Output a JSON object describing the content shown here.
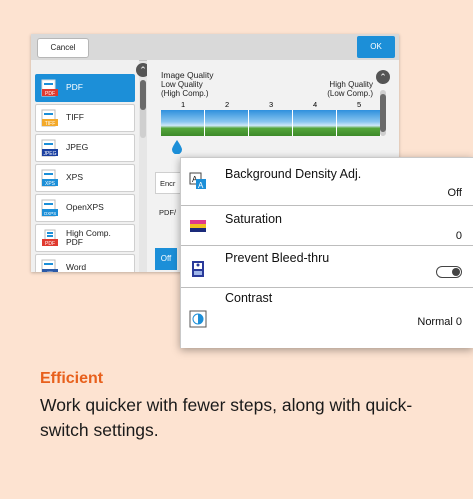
{
  "topbar": {
    "cancel_label": "Cancel",
    "ok_label": "OK"
  },
  "file_types": [
    {
      "label": "PDF",
      "icon": "pdf-file-icon",
      "badge": "PDF",
      "selected": true
    },
    {
      "label": "TIFF",
      "icon": "tiff-file-icon",
      "badge": "TIFF"
    },
    {
      "label": "JPEG",
      "icon": "jpeg-file-icon",
      "badge": "JPEG"
    },
    {
      "label": "XPS",
      "icon": "xps-file-icon",
      "badge": "XPS"
    },
    {
      "label": "OpenXPS",
      "icon": "openxps-file-icon",
      "badge": "OXPS"
    },
    {
      "label": "High Comp. PDF",
      "icon": "high-comp-pdf-icon",
      "badge": "PDF"
    },
    {
      "label": "Word",
      "icon": "word-file-icon",
      "badge": "W"
    }
  ],
  "image_quality": {
    "title": "Image Quality",
    "low_label": "Low Quality\n(High Comp.)",
    "high_label": "High Quality\n(Low Comp.)",
    "scale": [
      "1",
      "2",
      "3",
      "4",
      "5"
    ],
    "selected_level": 1
  },
  "subpanel": {
    "encr_label": "Encr",
    "pdfa_label": "PDF/",
    "pdfa2_label": "PDF/",
    "off_label": "Off"
  },
  "popup": {
    "rows": [
      {
        "title": "Background Density Adj.",
        "value": "Off",
        "icon": "background-density-icon"
      },
      {
        "title": "Saturation",
        "value": "0",
        "icon": "saturation-icon"
      },
      {
        "title": "Prevent Bleed-thru",
        "value": "",
        "icon": "prevent-bleed-thru-icon",
        "toggle": "off"
      },
      {
        "title": "Contrast",
        "value": "Normal 0",
        "icon": "contrast-icon"
      }
    ]
  },
  "caption": {
    "headline": "Efficient",
    "body": "Work quicker with fewer steps, along with quick-switch settings."
  },
  "colors": {
    "accent": "#1c8fd8",
    "headline": "#e8601c",
    "background": "#fde3d1"
  }
}
